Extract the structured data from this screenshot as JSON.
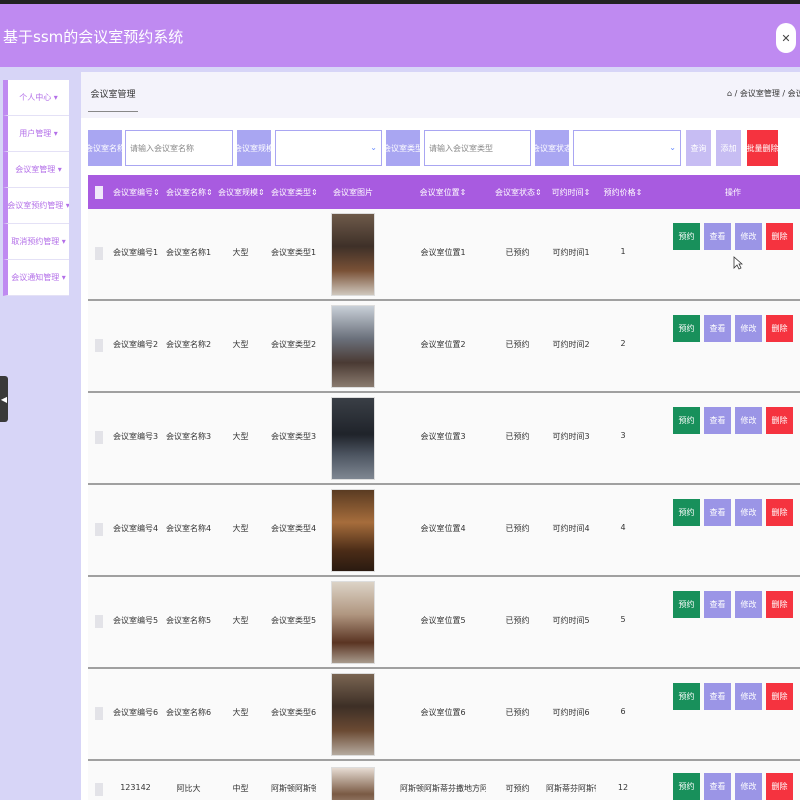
{
  "app": {
    "title": "基于ssm的会议室预约系统",
    "close_label": "✕"
  },
  "sidebar": {
    "items": [
      {
        "label": "个人中心 ▾"
      },
      {
        "label": "用户管理 ▾"
      },
      {
        "label": "会议室管理 ▾"
      },
      {
        "label": "会议室预约管理 ▾"
      },
      {
        "label": "取消预约管理 ▾"
      },
      {
        "label": "会议通知管理 ▾"
      }
    ]
  },
  "tab": {
    "label": "会议室管理"
  },
  "breadcrumb": {
    "home_icon": "⌂",
    "text": " / 会议室管理 / 会议室"
  },
  "search": {
    "name_label": "会议室名称",
    "name_placeholder": "请输入会议室名称",
    "size_label": "会议室规模",
    "type_label": "会议室类型",
    "type_placeholder": "请输入会议室类型",
    "status_label": "会议室状态",
    "query_btn": "查询",
    "add_btn": "添加",
    "batch_delete_btn": "批量删除",
    "arrow": "⌄"
  },
  "table": {
    "headers": [
      "会议室编号⇕",
      "会议室名称⇕",
      "会议室规模⇕",
      "会议室类型⇕",
      "会议室图片",
      "会议室位置⇕",
      "会议室状态⇕",
      "可约时间⇕",
      "预约价格⇕",
      "操作"
    ],
    "rows": [
      {
        "code": "会议室编号1",
        "name": "会议室名称1",
        "size": "大型",
        "type": "会议室类型1",
        "location": "会议室位置1",
        "status": "已预约",
        "time": "可约时间1",
        "price": "1"
      },
      {
        "code": "会议室编号2",
        "name": "会议室名称2",
        "size": "大型",
        "type": "会议室类型2",
        "location": "会议室位置2",
        "status": "已预约",
        "time": "可约时间2",
        "price": "2"
      },
      {
        "code": "会议室编号3",
        "name": "会议室名称3",
        "size": "大型",
        "type": "会议室类型3",
        "location": "会议室位置3",
        "status": "已预约",
        "time": "可约时间3",
        "price": "3"
      },
      {
        "code": "会议室编号4",
        "name": "会议室名称4",
        "size": "大型",
        "type": "会议室类型4",
        "location": "会议室位置4",
        "status": "已预约",
        "time": "可约时间4",
        "price": "4"
      },
      {
        "code": "会议室编号5",
        "name": "会议室名称5",
        "size": "大型",
        "type": "会议室类型5",
        "location": "会议室位置5",
        "status": "已预约",
        "time": "可约时间5",
        "price": "5"
      },
      {
        "code": "会议室编号6",
        "name": "会议室名称6",
        "size": "大型",
        "type": "会议室类型6",
        "location": "会议室位置6",
        "status": "已预约",
        "time": "可约时间6",
        "price": "6"
      },
      {
        "code": "123142",
        "name": "阿比大",
        "size": "中型",
        "type": "阿斯顿阿斯顿",
        "location": "阿斯顿阿斯蒂芬撒地方阿萨",
        "status": "可预约",
        "time": "阿斯蒂芬阿斯顿",
        "price": "12"
      }
    ],
    "actions": {
      "book": "预约",
      "view": "查看",
      "edit": "修改",
      "delete": "删除"
    }
  },
  "colors": {
    "header": "#bf8af1",
    "table_header": "#a85be0",
    "book": "#18905b",
    "delete": "#f5333f",
    "neutral_btn": "#9b95e6"
  }
}
